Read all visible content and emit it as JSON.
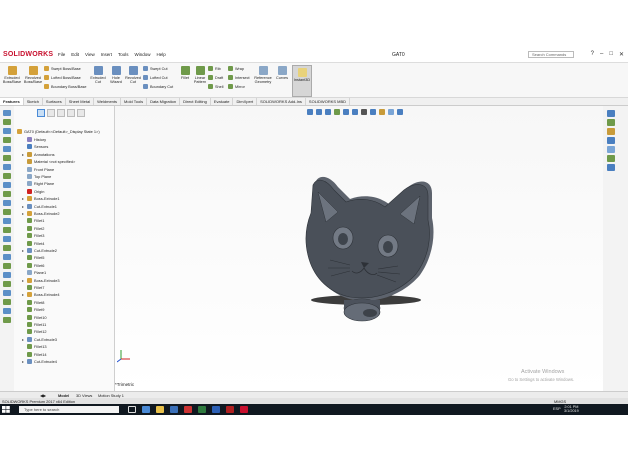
{
  "app": {
    "brand": "SOLIDWORKS",
    "doc_title": "GAT0",
    "search_placeholder": "Search Commands"
  },
  "menu": [
    "File",
    "Edit",
    "View",
    "Insert",
    "Tools",
    "Window",
    "Help"
  ],
  "window_buttons": [
    "?",
    "–",
    "□",
    "✕"
  ],
  "ribbon": {
    "large": [
      "Extruded Boss/Base",
      "Revolved Boss/Base",
      "Extruded Cut",
      "Hole Wizard",
      "Revolved Cut",
      "Fillet",
      "Linear Pattern",
      "Reference Geometry",
      "Curves",
      "Instant3D"
    ],
    "small": [
      "Swept Boss/Base",
      "Lofted Boss/Base",
      "Boundary Boss/Base",
      "Swept Cut",
      "Lofted Cut",
      "Boundary Cut",
      "Rib",
      "Draft",
      "Shell",
      "Wrap",
      "Intersect",
      "Mirror"
    ]
  },
  "tabs": [
    "Features",
    "Sketch",
    "Surfaces",
    "Sheet Metal",
    "Weldments",
    "Mold Tools",
    "Data Migration",
    "Direct Editing",
    "Evaluate",
    "DimXpert",
    "SOLIDWORKS Add-Ins",
    "SOLIDWORKS MBD"
  ],
  "tree": {
    "root": "GAT0 (Default<<Default>_Display State 1>)",
    "items": [
      "History",
      "Sensors",
      "Annotations",
      "Material <not specified>",
      "Front Plane",
      "Top Plane",
      "Right Plane",
      "Origin",
      "Boss-Extrude1",
      "Cut-Extrude1",
      "Boss-Extrude2",
      "Fillet1",
      "Fillet2",
      "Fillet3",
      "Fillet4",
      "Cut-Extrude2",
      "Fillet5",
      "Fillet6",
      "Plane1",
      "Boss-Extrude3",
      "Fillet7",
      "Boss-Extrude4",
      "Fillet8",
      "Fillet9",
      "Fillet10",
      "Fillet11",
      "Fillet12",
      "Cut-Extrude3",
      "Fillet13",
      "Fillet14",
      "Cut-Extrude4"
    ]
  },
  "viewport": {
    "view_name": "*Trimetric"
  },
  "watermark": {
    "title": "Activate Windows",
    "subtitle": "Go to Settings to activate Windows."
  },
  "bottom_tabs": [
    "Model",
    "3D Views",
    "Motion Study 1"
  ],
  "status": {
    "edition": "SOLIDWORKS Premium 2017 x64 Edition",
    "units": "MMGS"
  },
  "taskbar": {
    "search_placeholder": "Type here to search",
    "lang": "ESP",
    "time": "2:01 PM",
    "date": "3/1/2019"
  },
  "colors": {
    "model": "#4c525c",
    "model_light": "#8a919b",
    "accent": "#c8102e"
  }
}
